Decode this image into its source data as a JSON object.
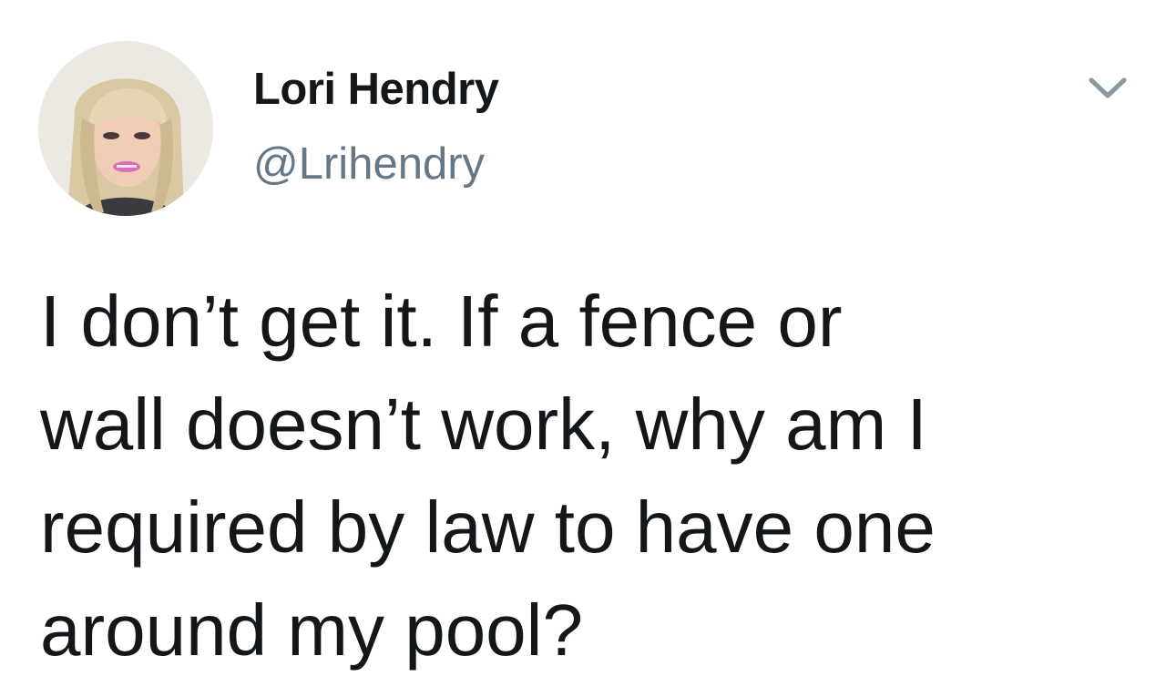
{
  "tweet": {
    "author": {
      "display_name": "Lori Hendry",
      "handle": "@Lrihendry",
      "avatar_icon": "profile-photo"
    },
    "menu_icon": "chevron-down-icon",
    "text": "I don’t get it.  If a fence or\nwall doesn’t work, why am I\nrequired by law to have one\naround my pool?"
  },
  "colors": {
    "text_primary": "#14171a",
    "text_secondary": "#657786",
    "caret": "#8899a6",
    "background": "#ffffff"
  }
}
